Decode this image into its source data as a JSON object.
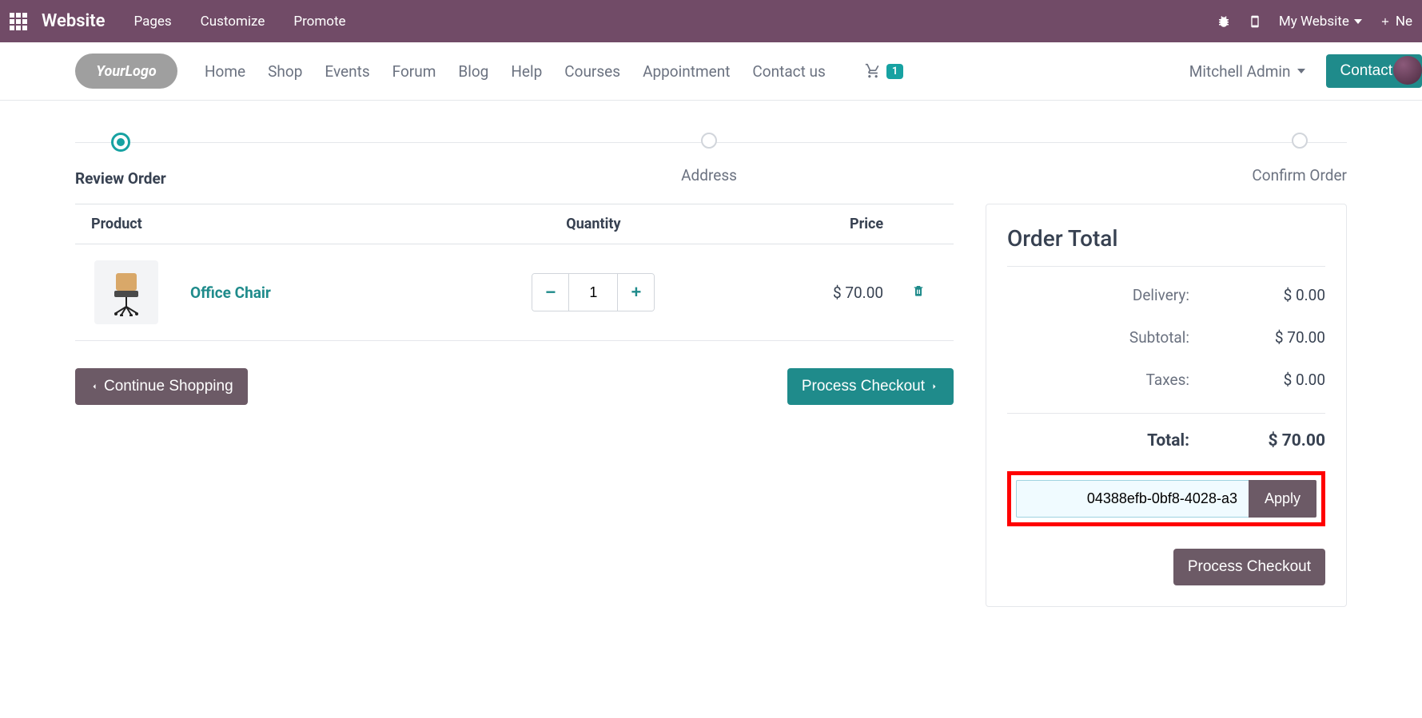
{
  "topbar": {
    "brand": "Website",
    "menu": [
      "Pages",
      "Customize",
      "Promote"
    ],
    "mywebsite": "My Website",
    "new": "Ne"
  },
  "nav": {
    "links": [
      "Home",
      "Shop",
      "Events",
      "Forum",
      "Blog",
      "Help",
      "Courses",
      "Appointment",
      "Contact us"
    ],
    "cart_count": "1",
    "user": "Mitchell Admin",
    "contact": "Contact U"
  },
  "steps": {
    "s1": "Review Order",
    "s2": "Address",
    "s3": "Confirm Order"
  },
  "table": {
    "h_product": "Product",
    "h_qty": "Quantity",
    "h_price": "Price",
    "item": {
      "name": "Office Chair",
      "qty": "1",
      "price": "$ 70.00"
    }
  },
  "actions": {
    "continue": "Continue Shopping",
    "process": "Process Checkout"
  },
  "summary": {
    "title": "Order Total",
    "delivery_label": "Delivery:",
    "delivery_val": "$ 0.00",
    "subtotal_label": "Subtotal:",
    "subtotal_val": "$ 70.00",
    "taxes_label": "Taxes:",
    "taxes_val": "$ 0.00",
    "total_label": "Total:",
    "total_val": "$ 70.00",
    "coupon_value": "04388efb-0bf8-4028-a3",
    "apply": "Apply",
    "process": "Process Checkout"
  }
}
